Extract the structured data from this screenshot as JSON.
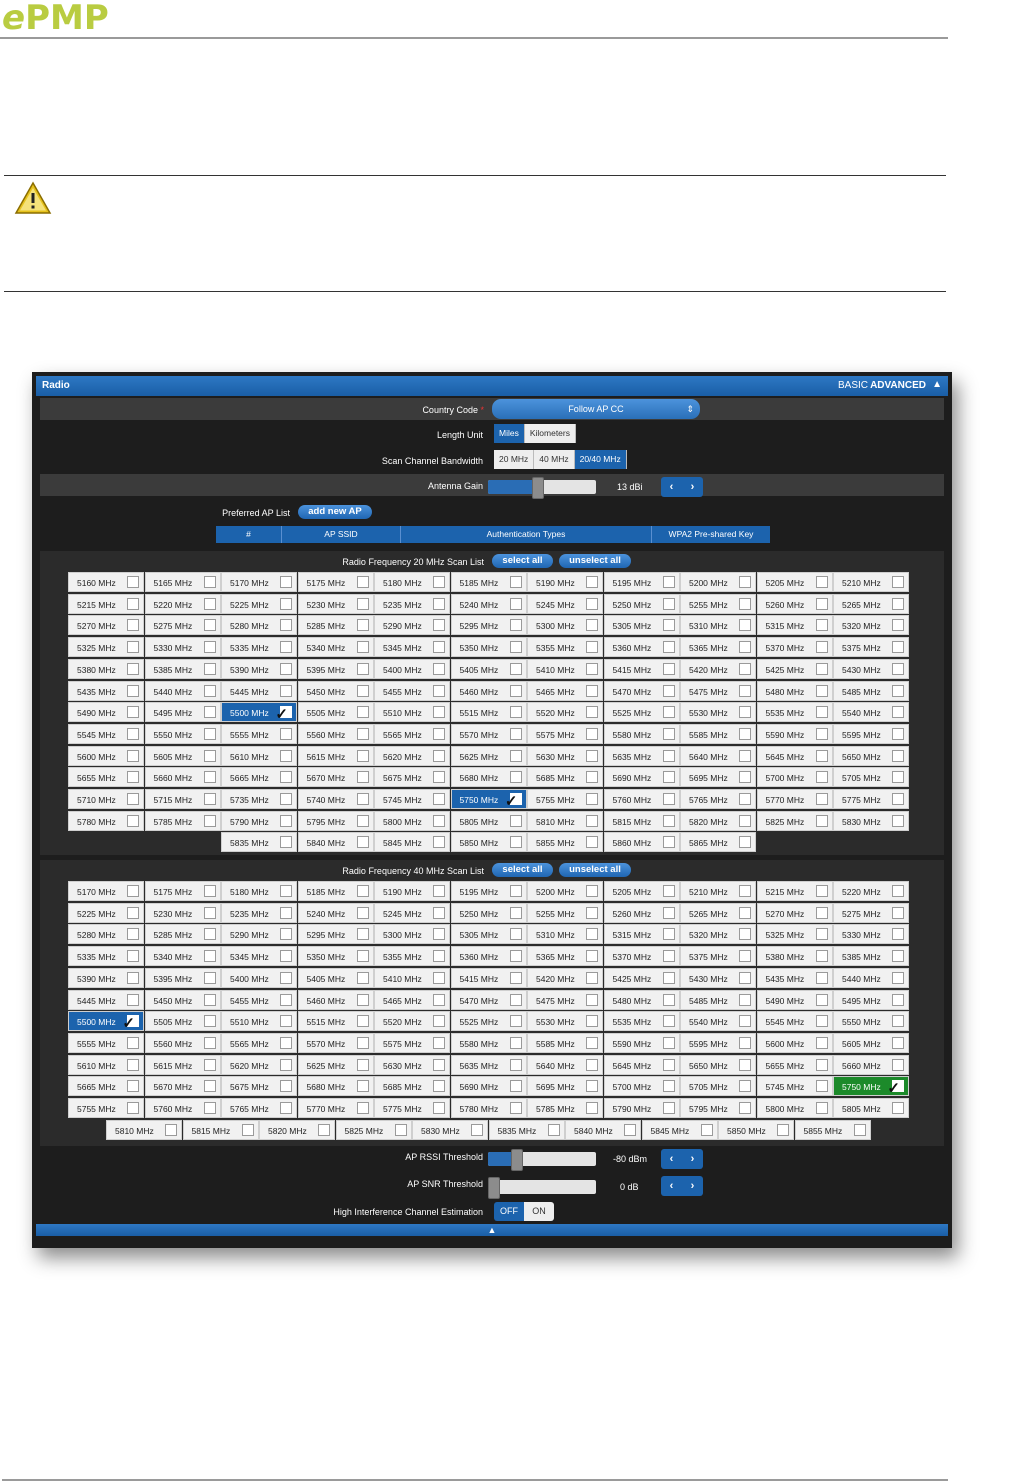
{
  "brand": {
    "logo_e": "e",
    "logo_rest": "PMP",
    "color": "#b9cc41"
  },
  "panel": {
    "title": "Radio",
    "mode_basic": "BASIC",
    "mode_advanced": "ADVANCED",
    "country_code_label": "Country Code",
    "required_mark": "*",
    "country_code_value": "Follow AP CC",
    "length_unit_label": "Length Unit",
    "length_unit_options": [
      "Miles",
      "Kilometers"
    ],
    "length_unit_selected": "Miles",
    "scan_bw_label": "Scan Channel Bandwidth",
    "scan_bw_options": [
      "20 MHz",
      "40 MHz",
      "20/40 MHz"
    ],
    "scan_bw_selected": "20/40 MHz",
    "antenna_gain_label": "Antenna Gain",
    "antenna_gain_value": "13 dBi",
    "antenna_gain_level": 0.45,
    "preferred_ap_label": "Preferred AP List",
    "add_ap_button": "add new AP",
    "ap_table_headers": [
      "#",
      "AP SSID",
      "Authentication Types",
      "WPA2 Pre-shared Key"
    ],
    "scan20_label": "Radio Frequency 20 MHz Scan List",
    "scan40_label": "Radio Frequency 40 MHz Scan List",
    "select_all": "select all",
    "unselect_all": "unselect all",
    "rssi_label": "AP RSSI Threshold",
    "rssi_value": "-80 dBm",
    "rssi_level": 0.26,
    "snr_label": "AP SNR Threshold",
    "snr_value": "0 dB",
    "snr_level": 0.05,
    "hice_label": "High Interference Channel Estimation",
    "hice_options": [
      "OFF",
      "ON"
    ],
    "hice_selected": "OFF",
    "arrow_left": "‹",
    "arrow_right": "›",
    "collapse_icon": "chevron-up-icon"
  },
  "freq20": {
    "selected": [
      "5500 MHz",
      "5750 MHz"
    ],
    "rows": [
      [
        "5160 MHz",
        "5165 MHz",
        "5170 MHz",
        "5175 MHz",
        "5180 MHz",
        "5185 MHz",
        "5190 MHz",
        "5195 MHz",
        "5200 MHz",
        "5205 MHz",
        "5210 MHz"
      ],
      [
        "5215 MHz",
        "5220 MHz",
        "5225 MHz",
        "5230 MHz",
        "5235 MHz",
        "5240 MHz",
        "5245 MHz",
        "5250 MHz",
        "5255 MHz",
        "5260 MHz",
        "5265 MHz"
      ],
      [
        "5270 MHz",
        "5275 MHz",
        "5280 MHz",
        "5285 MHz",
        "5290 MHz",
        "5295 MHz",
        "5300 MHz",
        "5305 MHz",
        "5310 MHz",
        "5315 MHz",
        "5320 MHz"
      ],
      [
        "5325 MHz",
        "5330 MHz",
        "5335 MHz",
        "5340 MHz",
        "5345 MHz",
        "5350 MHz",
        "5355 MHz",
        "5360 MHz",
        "5365 MHz",
        "5370 MHz",
        "5375 MHz"
      ],
      [
        "5380 MHz",
        "5385 MHz",
        "5390 MHz",
        "5395 MHz",
        "5400 MHz",
        "5405 MHz",
        "5410 MHz",
        "5415 MHz",
        "5420 MHz",
        "5425 MHz",
        "5430 MHz"
      ],
      [
        "5435 MHz",
        "5440 MHz",
        "5445 MHz",
        "5450 MHz",
        "5455 MHz",
        "5460 MHz",
        "5465 MHz",
        "5470 MHz",
        "5475 MHz",
        "5480 MHz",
        "5485 MHz"
      ],
      [
        "5490 MHz",
        "5495 MHz",
        "5500 MHz",
        "5505 MHz",
        "5510 MHz",
        "5515 MHz",
        "5520 MHz",
        "5525 MHz",
        "5530 MHz",
        "5535 MHz",
        "5540 MHz"
      ],
      [
        "5545 MHz",
        "5550 MHz",
        "5555 MHz",
        "5560 MHz",
        "5565 MHz",
        "5570 MHz",
        "5575 MHz",
        "5580 MHz",
        "5585 MHz",
        "5590 MHz",
        "5595 MHz"
      ],
      [
        "5600 MHz",
        "5605 MHz",
        "5610 MHz",
        "5615 MHz",
        "5620 MHz",
        "5625 MHz",
        "5630 MHz",
        "5635 MHz",
        "5640 MHz",
        "5645 MHz",
        "5650 MHz"
      ],
      [
        "5655 MHz",
        "5660 MHz",
        "5665 MHz",
        "5670 MHz",
        "5675 MHz",
        "5680 MHz",
        "5685 MHz",
        "5690 MHz",
        "5695 MHz",
        "5700 MHz",
        "5705 MHz"
      ],
      [
        "5710 MHz",
        "5715 MHz",
        "5735 MHz",
        "5740 MHz",
        "5745 MHz",
        "5750 MHz",
        "5755 MHz",
        "5760 MHz",
        "5765 MHz",
        "5770 MHz",
        "5775 MHz"
      ],
      [
        "5780 MHz",
        "5785 MHz",
        "5790 MHz",
        "5795 MHz",
        "5800 MHz",
        "5805 MHz",
        "5810 MHz",
        "5815 MHz",
        "5820 MHz",
        "5825 MHz",
        "5830 MHz"
      ],
      [
        "5835 MHz",
        "5840 MHz",
        "5845 MHz",
        "5850 MHz",
        "5855 MHz",
        "5860 MHz",
        "5865 MHz"
      ]
    ]
  },
  "freq40": {
    "selected": [
      "5500 MHz"
    ],
    "green": [
      "5750 MHz"
    ],
    "rows": [
      [
        "5170 MHz",
        "5175 MHz",
        "5180 MHz",
        "5185 MHz",
        "5190 MHz",
        "5195 MHz",
        "5200 MHz",
        "5205 MHz",
        "5210 MHz",
        "5215 MHz",
        "5220 MHz"
      ],
      [
        "5225 MHz",
        "5230 MHz",
        "5235 MHz",
        "5240 MHz",
        "5245 MHz",
        "5250 MHz",
        "5255 MHz",
        "5260 MHz",
        "5265 MHz",
        "5270 MHz",
        "5275 MHz"
      ],
      [
        "5280 MHz",
        "5285 MHz",
        "5290 MHz",
        "5295 MHz",
        "5300 MHz",
        "5305 MHz",
        "5310 MHz",
        "5315 MHz",
        "5320 MHz",
        "5325 MHz",
        "5330 MHz"
      ],
      [
        "5335 MHz",
        "5340 MHz",
        "5345 MHz",
        "5350 MHz",
        "5355 MHz",
        "5360 MHz",
        "5365 MHz",
        "5370 MHz",
        "5375 MHz",
        "5380 MHz",
        "5385 MHz"
      ],
      [
        "5390 MHz",
        "5395 MHz",
        "5400 MHz",
        "5405 MHz",
        "5410 MHz",
        "5415 MHz",
        "5420 MHz",
        "5425 MHz",
        "5430 MHz",
        "5435 MHz",
        "5440 MHz"
      ],
      [
        "5445 MHz",
        "5450 MHz",
        "5455 MHz",
        "5460 MHz",
        "5465 MHz",
        "5470 MHz",
        "5475 MHz",
        "5480 MHz",
        "5485 MHz",
        "5490 MHz",
        "5495 MHz"
      ],
      [
        "5500 MHz",
        "5505 MHz",
        "5510 MHz",
        "5515 MHz",
        "5520 MHz",
        "5525 MHz",
        "5530 MHz",
        "5535 MHz",
        "5540 MHz",
        "5545 MHz",
        "5550 MHz"
      ],
      [
        "5555 MHz",
        "5560 MHz",
        "5565 MHz",
        "5570 MHz",
        "5575 MHz",
        "5580 MHz",
        "5585 MHz",
        "5590 MHz",
        "5595 MHz",
        "5600 MHz",
        "5605 MHz"
      ],
      [
        "5610 MHz",
        "5615 MHz",
        "5620 MHz",
        "5625 MHz",
        "5630 MHz",
        "5635 MHz",
        "5640 MHz",
        "5645 MHz",
        "5650 MHz",
        "5655 MHz",
        "5660 MHz"
      ],
      [
        "5665 MHz",
        "5670 MHz",
        "5675 MHz",
        "5680 MHz",
        "5685 MHz",
        "5690 MHz",
        "5695 MHz",
        "5700 MHz",
        "5705 MHz",
        "5745 MHz",
        "5750 MHz"
      ],
      [
        "5755 MHz",
        "5760 MHz",
        "5765 MHz",
        "5770 MHz",
        "5775 MHz",
        "5780 MHz",
        "5785 MHz",
        "5790 MHz",
        "5795 MHz",
        "5800 MHz",
        "5805 MHz"
      ],
      [
        "5810 MHz",
        "5815 MHz",
        "5820 MHz",
        "5825 MHz",
        "5830 MHz",
        "5835 MHz",
        "5840 MHz",
        "5845 MHz",
        "5850 MHz",
        "5855 MHz"
      ]
    ]
  }
}
